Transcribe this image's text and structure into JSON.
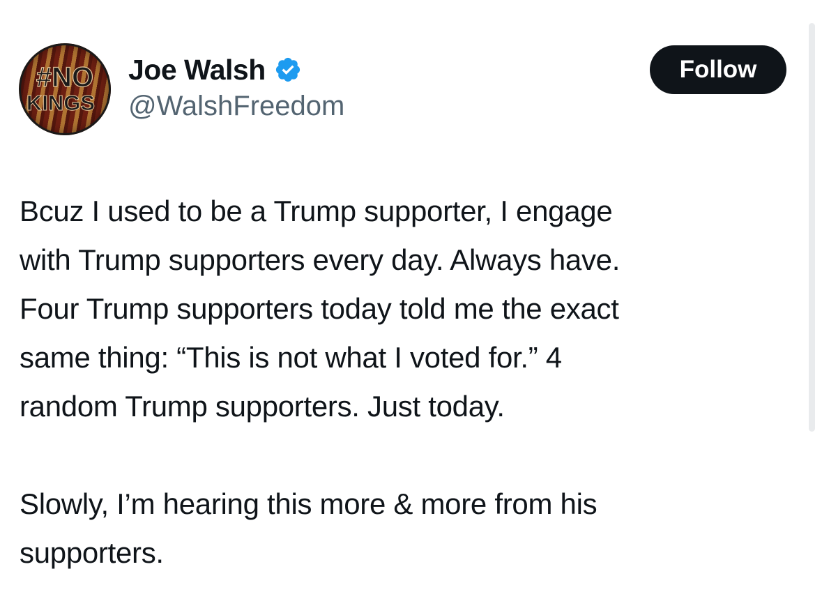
{
  "author": {
    "display_name": "Joe Walsh",
    "handle": "@WalshFreedom",
    "verified": true,
    "avatar_text_line1": "#NO",
    "avatar_text_line2": "KINGS",
    "avatar_icon": "no-kings-avatar-icon",
    "verified_icon": "verified-badge-icon"
  },
  "follow_button": {
    "label": "Follow"
  },
  "tweet": {
    "paragraphs": [
      [
        "Bcuz I used to be a Trump supporter, I engage",
        "with Trump supporters every day. Always have.",
        "Four Trump supporters today told me the exact",
        "same thing: “This is not what I voted for.” 4",
        "random Trump supporters. Just today."
      ],
      [
        "Slowly, I’m hearing this more & more from his",
        "supporters."
      ]
    ]
  },
  "colors": {
    "text": "#0f1419",
    "secondary_text": "#536471",
    "button_bg": "#0f1419",
    "button_text": "#ffffff",
    "verified_blue": "#1d9bf0"
  }
}
